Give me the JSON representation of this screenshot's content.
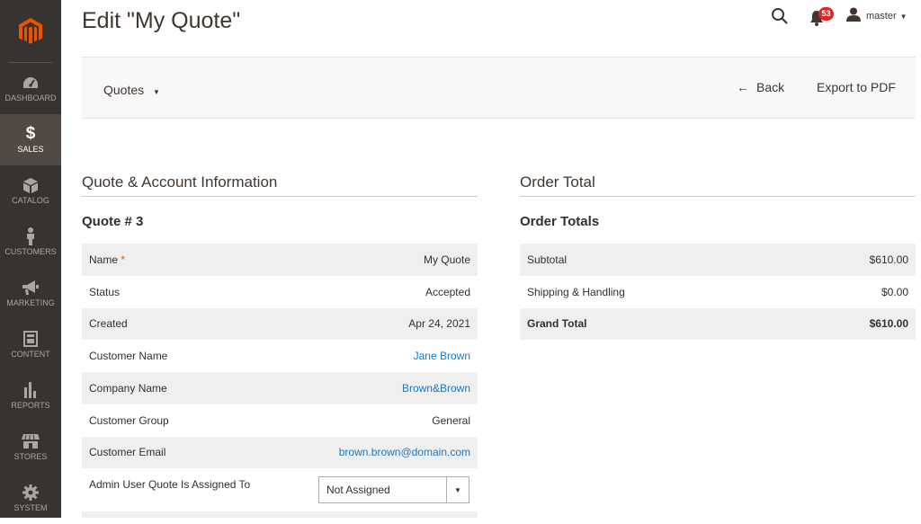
{
  "sidebar": {
    "logo_icon": "magento-logo",
    "items": [
      {
        "label": "DASHBOARD",
        "icon": "dashboard-icon"
      },
      {
        "label": "SALES",
        "icon": "dollar-icon",
        "active": true
      },
      {
        "label": "CATALOG",
        "icon": "cube-icon"
      },
      {
        "label": "CUSTOMERS",
        "icon": "person-icon"
      },
      {
        "label": "MARKETING",
        "icon": "megaphone-icon"
      },
      {
        "label": "CONTENT",
        "icon": "layout-icon"
      },
      {
        "label": "REPORTS",
        "icon": "bar-chart-icon"
      },
      {
        "label": "STORES",
        "icon": "store-icon"
      },
      {
        "label": "SYSTEM",
        "icon": "gear-icon"
      }
    ]
  },
  "header": {
    "title": "Edit \"My Quote\"",
    "notifications_count": "53",
    "user_name": "master"
  },
  "toolbar": {
    "quotes_label": "Quotes",
    "back_label": "Back",
    "export_label": "Export to PDF"
  },
  "quote_info": {
    "section_title": "Quote & Account Information",
    "subtitle": "Quote # 3",
    "rows": [
      {
        "label": "Name",
        "value": "My Quote"
      },
      {
        "label": "Status",
        "value": "Accepted"
      },
      {
        "label": "Created",
        "value": "Apr 24, 2021"
      },
      {
        "label": "Customer Name",
        "value": "Jane Brown"
      },
      {
        "label": "Company Name",
        "value": "Brown&Brown"
      },
      {
        "label": "Customer Group",
        "value": "General"
      },
      {
        "label": "Customer Email",
        "value": "brown.brown@domain.com"
      }
    ],
    "required_mark": "*",
    "assigned_label": "Admin User Quote Is Assigned To",
    "assigned_value": "Not Assigned"
  },
  "order_total": {
    "section_title": "Order Total",
    "subtitle": "Order Totals",
    "rows": [
      {
        "label": "Subtotal",
        "value": "$610.00"
      },
      {
        "label": "Shipping & Handling",
        "value": "$0.00"
      },
      {
        "label": "Grand Total",
        "value": "$610.00"
      }
    ]
  },
  "colors": {
    "sidebar_bg": "#373330",
    "sidebar_active": "#514943",
    "logo_orange": "#eb5202",
    "link": "#1979c3",
    "badge": "#e22626"
  }
}
